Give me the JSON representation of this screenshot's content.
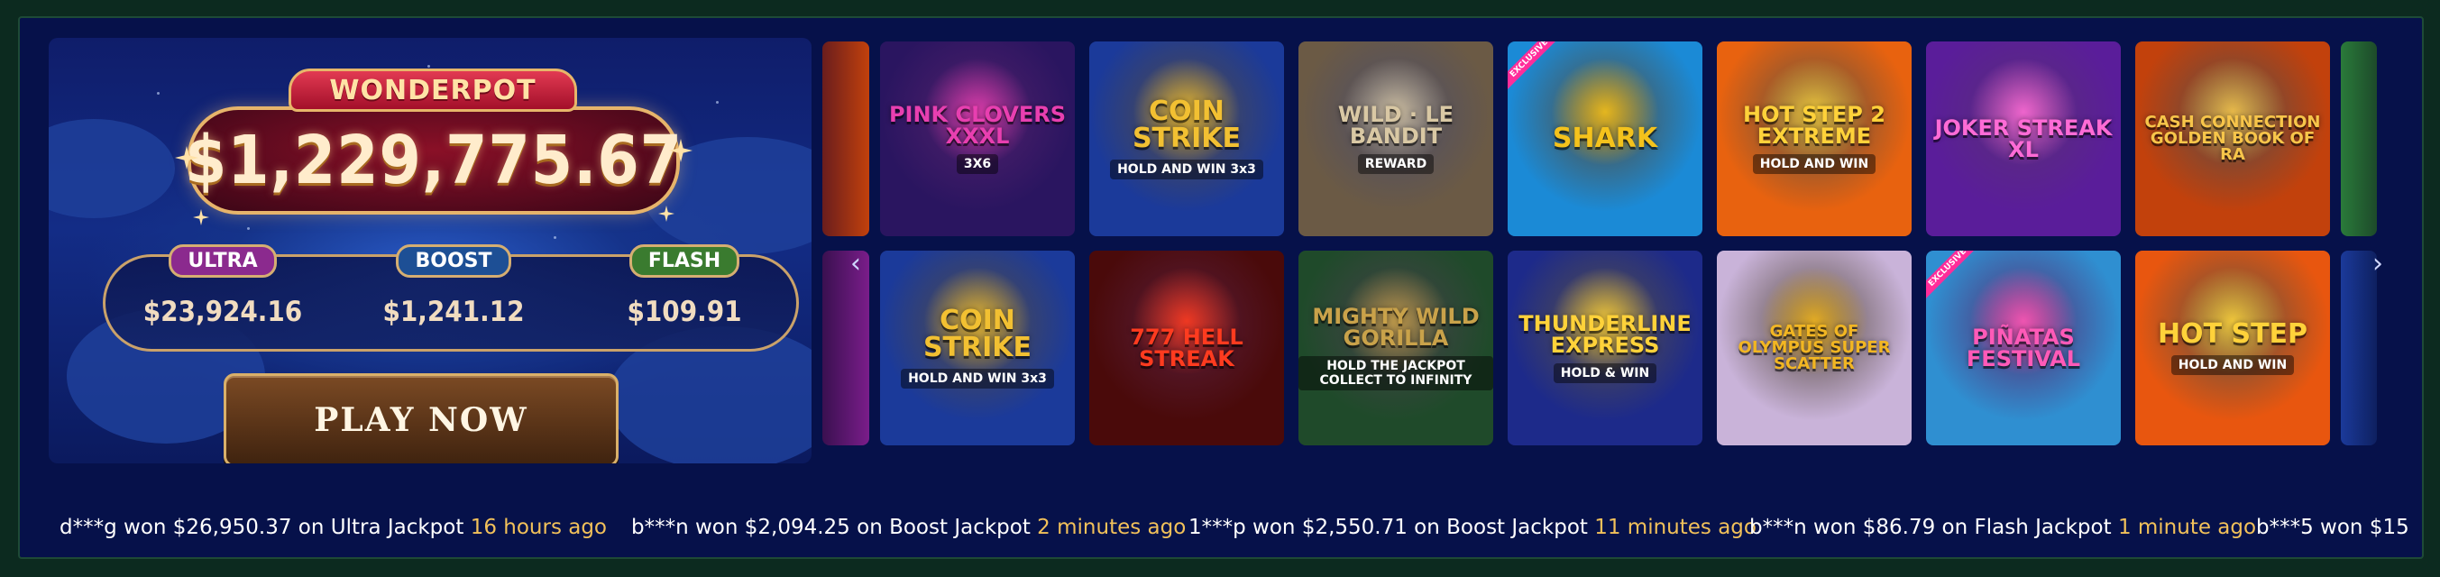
{
  "jackpot": {
    "brand": "WONDERPOT",
    "amount": "$1,229,775.67",
    "tiers": [
      {
        "name": "ULTRA",
        "value": "$23,924.16"
      },
      {
        "name": "BOOST",
        "value": "$1,241.12"
      },
      {
        "name": "FLASH",
        "value": "$109.91"
      }
    ],
    "play_label": "PLAY NOW"
  },
  "carousel": {
    "prev_icon": "chevron-left-icon",
    "next_icon": "chevron-right-icon",
    "row1": [
      {
        "title": "PINK CLOVERS XXXL",
        "sub": "3X6",
        "bg": "#2a1560",
        "accent": "#e83fb0"
      },
      {
        "title": "COIN STRIKE",
        "sub": "HOLD AND WIN 3x3",
        "bg": "#1b3a9a",
        "accent": "#f2c032"
      },
      {
        "title": "WILD · LE BANDIT",
        "sub": "REWARD",
        "bg": "#6b5a45",
        "accent": "#d9c8a4"
      },
      {
        "title": "SHARK",
        "sub": "EXCLUSIVE",
        "bg": "#1b8ad6",
        "accent": "#f4c21c"
      },
      {
        "title": "HOT STEP 2 EXTREME",
        "sub": "HOLD AND WIN",
        "bg": "#e8620f",
        "accent": "#ffd23a"
      },
      {
        "title": "JOKER STREAK XL",
        "sub": "",
        "bg": "#5a1d9a",
        "accent": "#ff6bd6"
      },
      {
        "title": "CASH CONNECTION GOLDEN BOOK OF RA",
        "sub": "",
        "bg": "#c2410c",
        "accent": "#f7c54a"
      }
    ],
    "row2": [
      {
        "title": "COIN STRIKE",
        "sub": "HOLD AND WIN 3x3",
        "bg": "#1b3a9a",
        "accent": "#f2c032"
      },
      {
        "title": "777 HELL STREAK",
        "sub": "",
        "bg": "#4a0a0a",
        "accent": "#ff3b1f"
      },
      {
        "title": "MIGHTY WILD GORILLA",
        "sub": "HOLD THE JACKPOT COLLECT TO INFINITY",
        "bg": "#1f4a2a",
        "accent": "#c9a24a"
      },
      {
        "title": "THUNDERLINE EXPRESS",
        "sub": "HOLD & WIN",
        "bg": "#1d2a8a",
        "accent": "#ffd23a"
      },
      {
        "title": "GATES OF OLYMPUS SUPER SCATTER",
        "sub": "",
        "bg": "#c9b3d9",
        "accent": "#f2b622"
      },
      {
        "title": "PIÑATAS FESTIVAL",
        "sub": "EXCLUSIVE",
        "bg": "#2f8fd1",
        "accent": "#ff5ab8"
      },
      {
        "title": "HOT STEP",
        "sub": "HOLD AND WIN",
        "bg": "#e8560f",
        "accent": "#ffd23a"
      }
    ]
  },
  "ticker": [
    {
      "text": "d***g won $26,950.37 on Ultra Jackpot ",
      "ago": "16 hours ago"
    },
    {
      "text": "b***n won $2,094.25 on Boost Jackpot ",
      "ago": "2 minutes ago"
    },
    {
      "text": "1***p won $2,550.71 on Boost Jackpot ",
      "ago": "11 minutes ago"
    },
    {
      "text": "b***n won $86.79 on Flash Jackpot ",
      "ago": "1 minute ago"
    },
    {
      "text": "b***5 won $15",
      "ago": ""
    }
  ]
}
